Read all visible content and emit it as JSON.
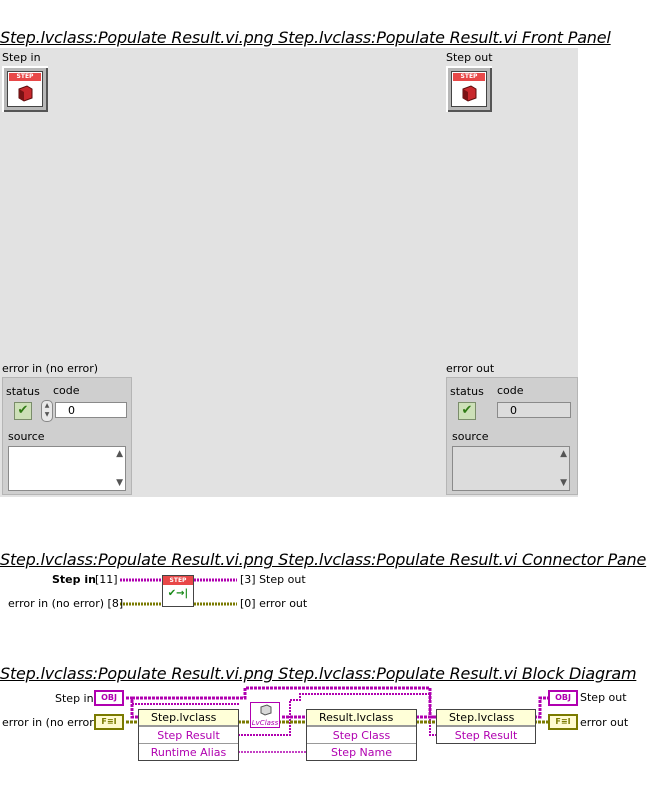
{
  "front_panel": {
    "title": "Step.lvclass:Populate Result.vi.png  Step.lvclass:Populate Result.vi Front Panel",
    "step_in_label": "Step in",
    "step_out_label": "Step out",
    "step_icon_text": "STEP",
    "error_in": {
      "label": "error in (no error)",
      "status_label": "status",
      "code_label": "code",
      "code_value": "0",
      "source_label": "source",
      "status_glyph": "✔"
    },
    "error_out": {
      "label": "error out",
      "status_label": "status",
      "code_label": "code",
      "code_value": "0",
      "source_label": "source",
      "status_glyph": "✔"
    }
  },
  "connector_pane": {
    "title": "Step.lvclass:Populate Result.vi.png  Step.lvclass:Populate Result.vi Connector Pane",
    "step_in": "Step in",
    "step_in_index": "[11]",
    "error_in": "error in (no error) [8]",
    "step_out": "[3] Step out",
    "error_out": "[0] error out",
    "icon_text": "STEP",
    "icon_glyph": "✔→|"
  },
  "block_diagram": {
    "title": "Step.lvclass:Populate Result.vi.png  Step.lvclass:Populate Result.vi Block Diagram",
    "step_in": "Step in",
    "error_in": "error in (no error)",
    "step_out": "Step out",
    "error_out": "error out",
    "obj_terminal": "OBJ",
    "err_terminal": "F≡I",
    "node1": {
      "header": "Step.lvclass",
      "rows": [
        "Step Result",
        "Runtime Alias"
      ]
    },
    "class_const": "LvClass",
    "node2": {
      "header": "Result.lvclass",
      "rows": [
        "Step Class",
        "Step Name"
      ]
    },
    "node3": {
      "header": "Step.lvclass",
      "rows": [
        "Step Result"
      ]
    }
  },
  "colors": {
    "class_wire": "#b000b0",
    "error_wire": "#7a7a00",
    "panel": "#e2e2e2",
    "icon_red": "#e84848"
  }
}
